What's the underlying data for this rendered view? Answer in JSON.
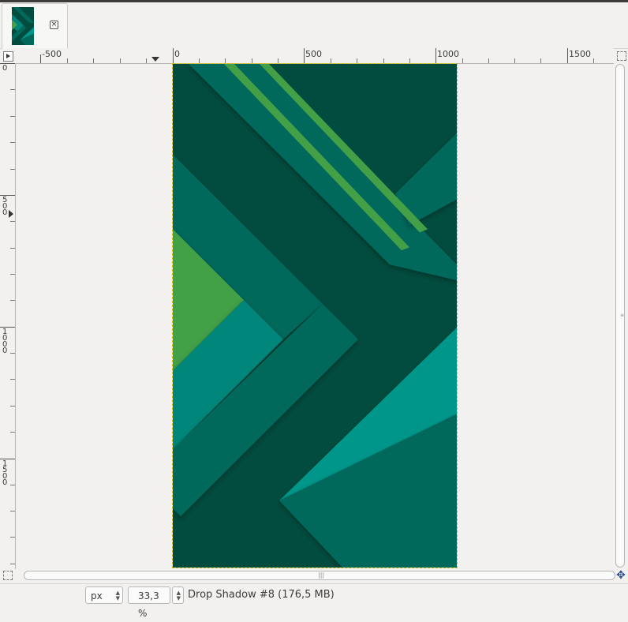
{
  "tabs": [
    {
      "close_icon": "close-icon"
    }
  ],
  "hruler": {
    "labels": [
      "-500",
      "0",
      "500",
      "1000",
      "1500"
    ]
  },
  "vruler": {
    "labels": [
      "0",
      "500",
      "1000",
      "1500"
    ]
  },
  "status": {
    "unit": "px",
    "zoom": "33,3 %",
    "message": "Drop Shadow #8 (176,5 MB)"
  },
  "colors": {
    "bg_dark": "#024c3f",
    "teal_mid": "#00695b",
    "teal_light": "#00867a",
    "teal_bright": "#00968a",
    "green": "#43a047"
  }
}
